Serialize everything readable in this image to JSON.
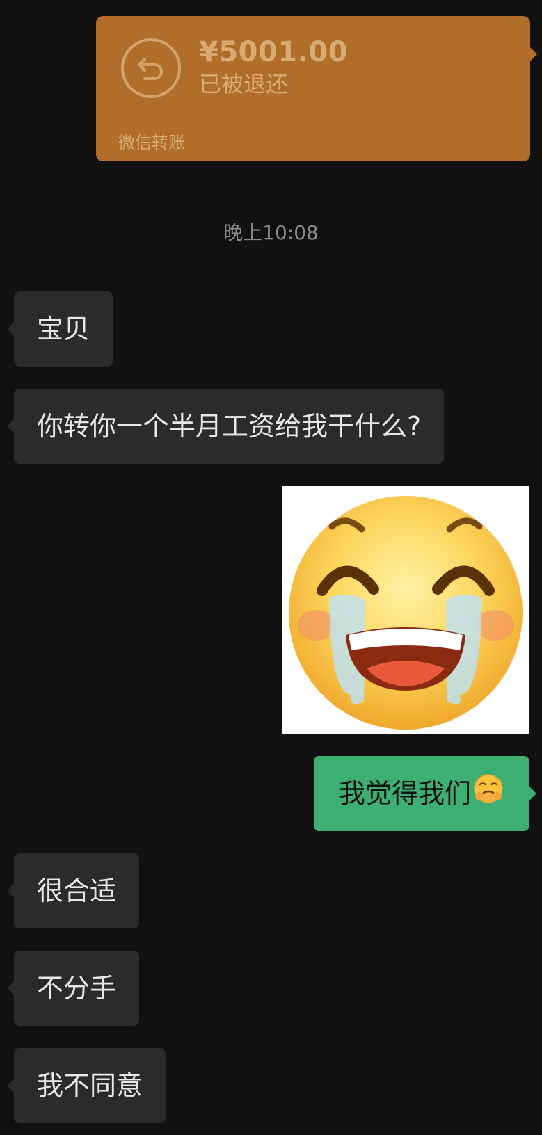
{
  "transfer": {
    "amount": "¥5001.00",
    "status": "已被退还",
    "source": "微信转账",
    "icon": "return-arrow-icon",
    "color": "#b06e2a"
  },
  "timestamp": "晚上10:08",
  "messages": [
    {
      "side": "left",
      "text": "宝贝"
    },
    {
      "side": "left",
      "text": "你转你一个半月工资给我干什么?"
    },
    {
      "side": "right",
      "type": "sticker",
      "sticker": "laughing-crying-face-icon"
    },
    {
      "side": "right",
      "text": "我觉得我们",
      "emoji": "pleading-face-icon"
    },
    {
      "side": "left",
      "text": "很合适"
    },
    {
      "side": "left",
      "text": "不分手"
    },
    {
      "side": "left",
      "text": "我不同意"
    }
  ],
  "colors": {
    "background": "#111111",
    "incoming_bubble": "#2b2b2b",
    "outgoing_bubble": "#3daf72"
  }
}
